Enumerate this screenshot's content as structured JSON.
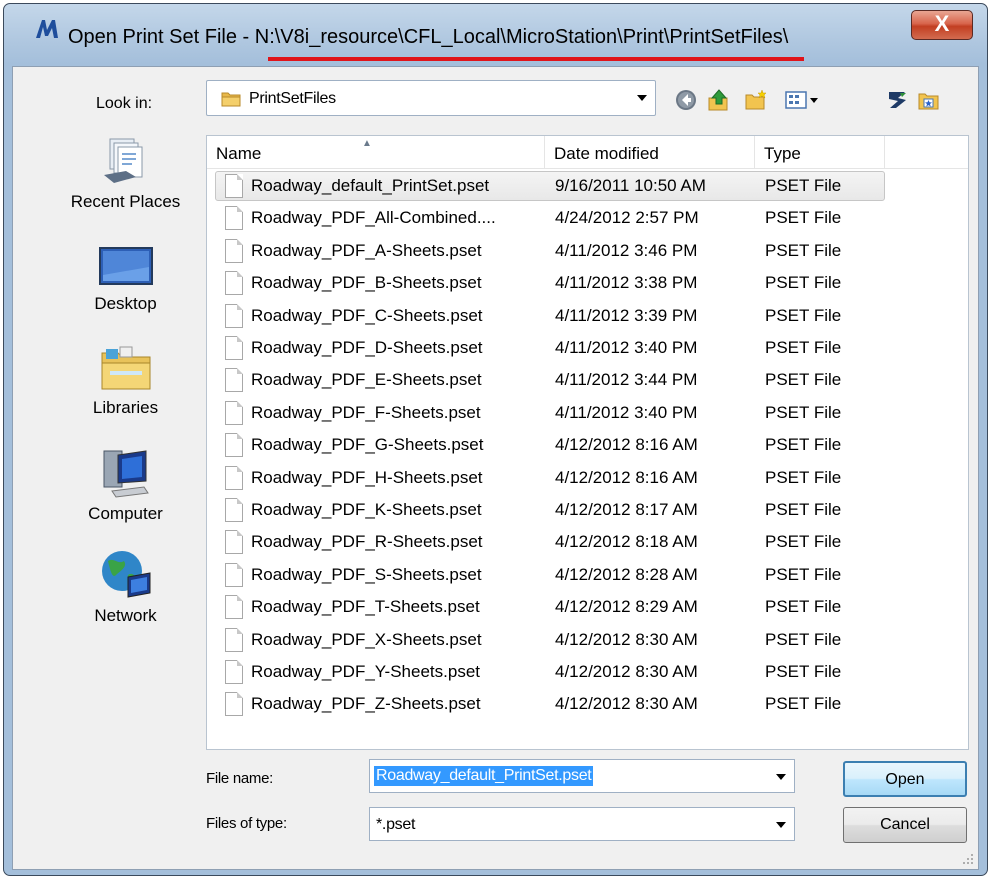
{
  "window": {
    "title_prefix": "Open Print Set File - ",
    "title_path": "N:\\V8i_resource\\CFL_Local\\MicroStation\\Print\\PrintSetFiles\\",
    "close_label": "X"
  },
  "lookin": {
    "label": "Look in:",
    "value": "PrintSetFiles"
  },
  "places": [
    {
      "label": "Recent Places",
      "icon": "recent-places-icon"
    },
    {
      "label": "Desktop",
      "icon": "desktop-icon"
    },
    {
      "label": "Libraries",
      "icon": "libraries-icon"
    },
    {
      "label": "Computer",
      "icon": "computer-icon"
    },
    {
      "label": "Network",
      "icon": "network-icon"
    }
  ],
  "columns": {
    "name": "Name",
    "date": "Date modified",
    "type": "Type"
  },
  "files": [
    {
      "name": "Roadway_default_PrintSet.pset",
      "date": "9/16/2011 10:50 AM",
      "type": "PSET File",
      "selected": true
    },
    {
      "name": "Roadway_PDF_All-Combined....",
      "date": "4/24/2012 2:57 PM",
      "type": "PSET File"
    },
    {
      "name": "Roadway_PDF_A-Sheets.pset",
      "date": "4/11/2012 3:46 PM",
      "type": "PSET File"
    },
    {
      "name": "Roadway_PDF_B-Sheets.pset",
      "date": "4/11/2012 3:38 PM",
      "type": "PSET File"
    },
    {
      "name": "Roadway_PDF_C-Sheets.pset",
      "date": "4/11/2012 3:39 PM",
      "type": "PSET File"
    },
    {
      "name": "Roadway_PDF_D-Sheets.pset",
      "date": "4/11/2012 3:40 PM",
      "type": "PSET File"
    },
    {
      "name": "Roadway_PDF_E-Sheets.pset",
      "date": "4/11/2012 3:44 PM",
      "type": "PSET File"
    },
    {
      "name": "Roadway_PDF_F-Sheets.pset",
      "date": "4/11/2012 3:40 PM",
      "type": "PSET File"
    },
    {
      "name": "Roadway_PDF_G-Sheets.pset",
      "date": "4/12/2012 8:16 AM",
      "type": "PSET File"
    },
    {
      "name": "Roadway_PDF_H-Sheets.pset",
      "date": "4/12/2012 8:16 AM",
      "type": "PSET File"
    },
    {
      "name": "Roadway_PDF_K-Sheets.pset",
      "date": "4/12/2012 8:17 AM",
      "type": "PSET File"
    },
    {
      "name": "Roadway_PDF_R-Sheets.pset",
      "date": "4/12/2012 8:18 AM",
      "type": "PSET File"
    },
    {
      "name": "Roadway_PDF_S-Sheets.pset",
      "date": "4/12/2012 8:28 AM",
      "type": "PSET File"
    },
    {
      "name": "Roadway_PDF_T-Sheets.pset",
      "date": "4/12/2012 8:29 AM",
      "type": "PSET File"
    },
    {
      "name": "Roadway_PDF_X-Sheets.pset",
      "date": "4/12/2012 8:30 AM",
      "type": "PSET File"
    },
    {
      "name": "Roadway_PDF_Y-Sheets.pset",
      "date": "4/12/2012 8:30 AM",
      "type": "PSET File"
    },
    {
      "name": "Roadway_PDF_Z-Sheets.pset",
      "date": "4/12/2012 8:30 AM",
      "type": "PSET File"
    }
  ],
  "filename": {
    "label": "File name:",
    "value": "Roadway_default_PrintSet.pset"
  },
  "filetype": {
    "label": "Files of type:",
    "value": "*.pset"
  },
  "buttons": {
    "open": "Open",
    "cancel": "Cancel"
  },
  "colors": {
    "title_underline": "#e0141a",
    "selection": "#3399ff",
    "close_button": "#c94a2e"
  }
}
